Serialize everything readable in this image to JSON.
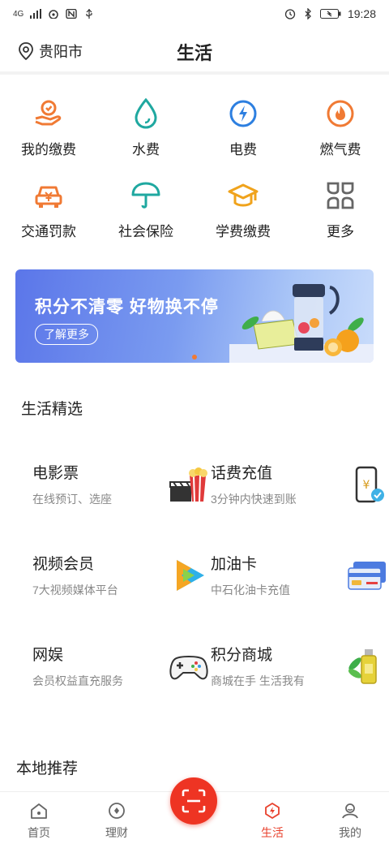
{
  "status": {
    "network": "4G",
    "time": "19:28"
  },
  "header": {
    "location": "贵阳市",
    "title": "生活"
  },
  "services": [
    {
      "label": "我的缴费",
      "icon": "payment-hand-icon"
    },
    {
      "label": "水费",
      "icon": "water-drop-icon"
    },
    {
      "label": "电费",
      "icon": "electricity-bolt-icon"
    },
    {
      "label": "燃气费",
      "icon": "gas-flame-icon"
    },
    {
      "label": "交通罚款",
      "icon": "car-fine-icon"
    },
    {
      "label": "社会保险",
      "icon": "umbrella-icon"
    },
    {
      "label": "学费缴费",
      "icon": "graduation-cap-icon"
    },
    {
      "label": "更多",
      "icon": "more-grid-icon"
    }
  ],
  "banner": {
    "text": "积分不清零 好物换不停",
    "button": "了解更多"
  },
  "section": {
    "title": "生活精选"
  },
  "picks": [
    {
      "name": "电影票",
      "desc": "在线预订、选座",
      "icon": "movie-popcorn-icon"
    },
    {
      "name": "话费充值",
      "desc": "3分钟内快速到账",
      "icon": "phone-recharge-icon"
    },
    {
      "name": "视频会员",
      "desc": "7大视频媒体平台",
      "icon": "video-play-icon"
    },
    {
      "name": "加油卡",
      "desc": "中石化油卡充值",
      "icon": "fuel-card-icon"
    },
    {
      "name": "网娱",
      "desc": "会员权益直充服务",
      "icon": "gamepad-icon"
    },
    {
      "name": "积分商城",
      "desc": "商城在手 生活我有",
      "icon": "points-mall-icon"
    }
  ],
  "local": {
    "title": "本地推荐"
  },
  "tabs": [
    {
      "label": "首页",
      "icon": "home-icon"
    },
    {
      "label": "理财",
      "icon": "wealth-icon"
    },
    {
      "label": "生活",
      "icon": "life-icon"
    },
    {
      "label": "我的",
      "icon": "profile-icon"
    }
  ],
  "colors": {
    "accent": "#ee3423",
    "orange": "#f07a34",
    "teal": "#1fa8a0",
    "blue": "#2d7fe0"
  }
}
